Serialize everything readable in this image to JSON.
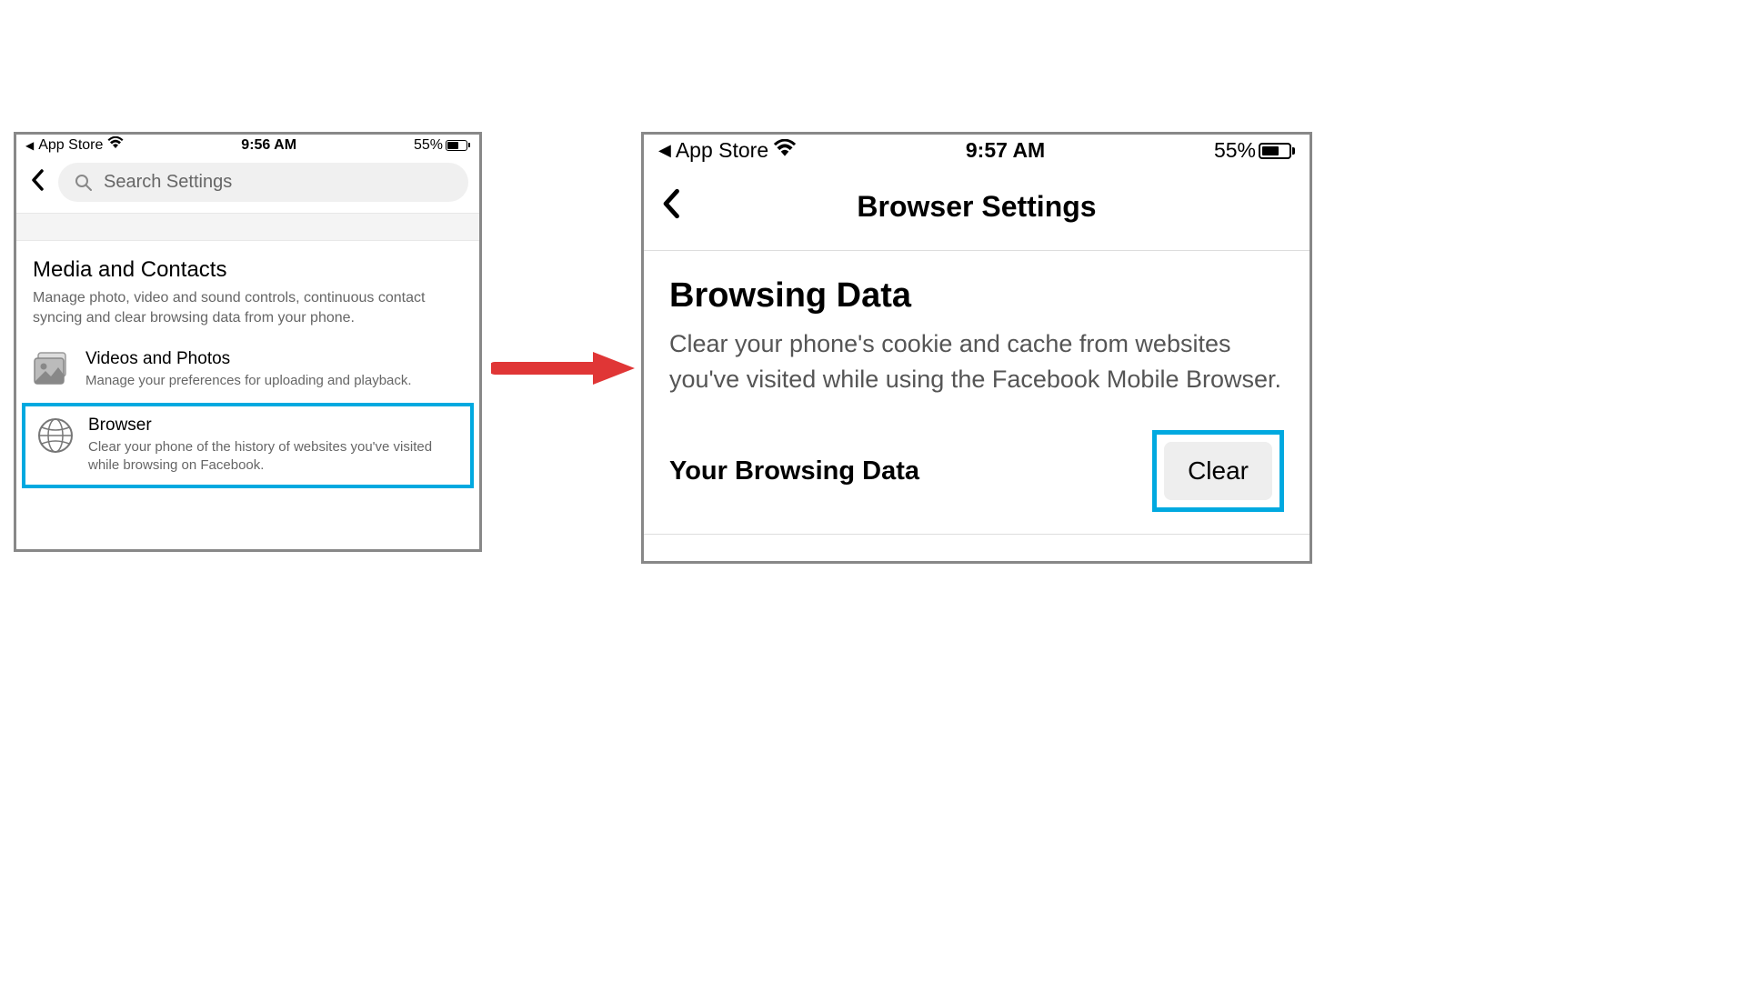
{
  "left": {
    "status": {
      "breadcrumb": "App Store",
      "time": "9:56 AM",
      "battery": "55%"
    },
    "search": {
      "placeholder": "Search Settings"
    },
    "section": {
      "title": "Media and Contacts",
      "desc": "Manage photo, video and sound controls, continuous contact syncing and clear browsing data from your phone."
    },
    "rows": [
      {
        "title": "Videos and Photos",
        "desc": "Manage your preferences for uploading and playback."
      },
      {
        "title": "Browser",
        "desc": "Clear your phone of the history of websites you've visited while browsing on Facebook."
      }
    ]
  },
  "right": {
    "status": {
      "breadcrumb": "App Store",
      "time": "9:57 AM",
      "battery": "55%"
    },
    "header": "Browser Settings",
    "section": {
      "title": "Browsing Data",
      "desc": "Clear your phone's cookie and cache from websites you've visited while using the Facebook Mobile Browser."
    },
    "clearRow": {
      "label": "Your Browsing Data",
      "button": "Clear"
    }
  }
}
